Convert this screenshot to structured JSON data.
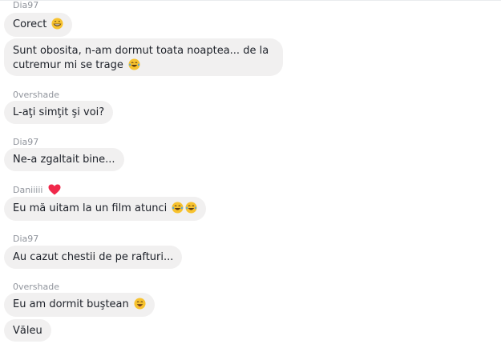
{
  "messages": [
    {
      "sender": "Dia97",
      "texts": [
        "Corect"
      ]
    },
    {
      "sender": "",
      "texts": [
        "Sunt obosita, n-am dormut toata noaptea... de la",
        "cutremur mi se trage"
      ]
    },
    {
      "sender": "0vershade",
      "texts": [
        "L-aţi simţit şi voi?"
      ]
    },
    {
      "sender": "Dia97",
      "texts": [
        "Ne-a zgaltait bine..."
      ]
    },
    {
      "sender": "Daniiiii",
      "texts": [
        "Eu mă uitam la un film atunci"
      ]
    },
    {
      "sender": "Dia97",
      "texts": [
        "Au cazut chestii de pe rafturi..."
      ]
    },
    {
      "sender": "0vershade",
      "texts": [
        "Eu am dormit  buştean"
      ]
    },
    {
      "sender": "",
      "texts": [
        "Văleu"
      ]
    }
  ],
  "icons": {
    "grin": "grinning-face-icon",
    "joy": "tears-of-joy-icon",
    "smile": "smiling-face-icon",
    "heart": "red-heart-icon"
  },
  "colors": {
    "bubble": "#f1f0f0",
    "name": "#90949c",
    "text": "#1d2129",
    "heart": "#f0284a"
  }
}
